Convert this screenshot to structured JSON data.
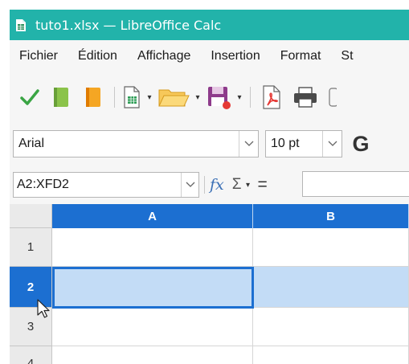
{
  "window": {
    "title": "tuto1.xlsx — LibreOffice Calc",
    "title_bar_color": "#22b3aa"
  },
  "menu": [
    {
      "label": "Fichier"
    },
    {
      "label": "Édition"
    },
    {
      "label": "Affichage"
    },
    {
      "label": "Insertion"
    },
    {
      "label": "Format"
    },
    {
      "label": "St"
    }
  ],
  "toolbar": {
    "icons": [
      "apply-check-icon",
      "green-book-icon",
      "orange-book-icon",
      "new-spreadsheet-icon",
      "open-folder-icon",
      "save-disk-icon",
      "pdf-export-icon",
      "print-icon"
    ]
  },
  "font_bar": {
    "font_name": "Arial",
    "font_size": "10 pt",
    "bold_glyph": "G"
  },
  "formula_bar": {
    "name_box": "A2:XFD2",
    "sigma": "Σ",
    "equals": "=",
    "formula_value": ""
  },
  "sheet": {
    "columns": [
      "A",
      "B"
    ],
    "rows": [
      "1",
      "2",
      "3",
      "4"
    ],
    "selected_row": "2",
    "accent_color": "#1c6fd1",
    "selection_fill": "#c3dcf6"
  }
}
